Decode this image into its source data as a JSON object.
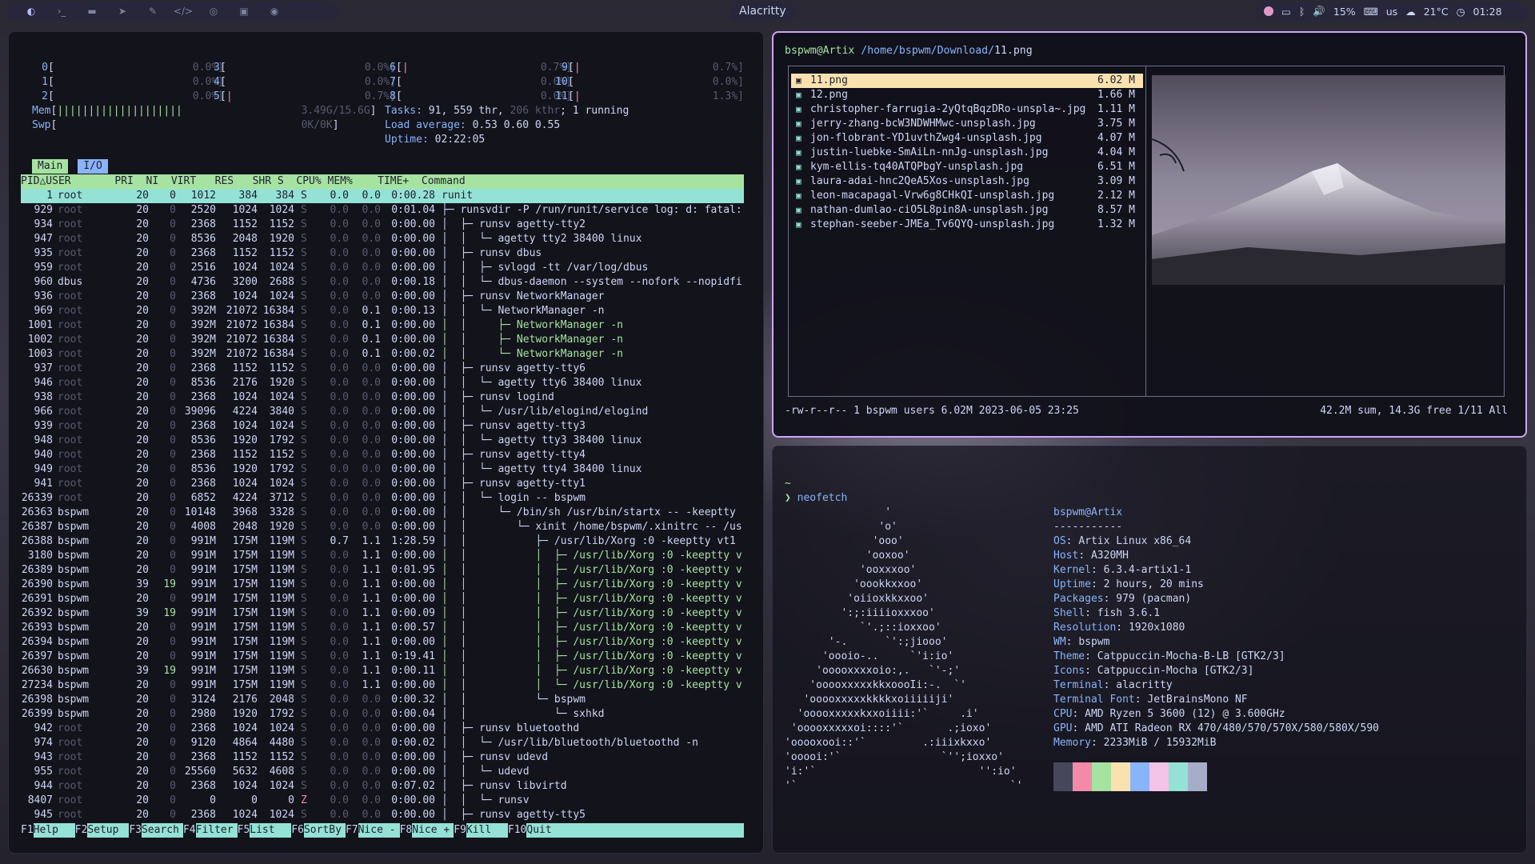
{
  "topbar": {
    "workspaces": [
      "",
      "",
      "",
      "",
      "",
      "",
      "",
      "",
      ""
    ],
    "title": "Alacritty",
    "battery": "15%",
    "keyboard": "us",
    "weather": "21°C",
    "clock": "01:28",
    "status_icons": [
      "wifi-icon",
      "display-icon",
      "bluetooth-icon"
    ]
  },
  "htop": {
    "cpus": [
      {
        "n": "0",
        "p": "0.0%"
      },
      {
        "n": "1",
        "p": "0.0%"
      },
      {
        "n": "2",
        "p": "0.0%"
      },
      {
        "n": "3",
        "p": "0.0%"
      },
      {
        "n": "4",
        "p": "0.0%"
      },
      {
        "n": "5",
        "p": "0.7%"
      },
      {
        "n": "6",
        "p": "0.7%"
      },
      {
        "n": "7",
        "p": "0.0%"
      },
      {
        "n": "8",
        "p": "0.0%"
      },
      {
        "n": "9",
        "p": "0.7%"
      },
      {
        "n": "10",
        "p": "0.0%"
      },
      {
        "n": "11",
        "p": "1.3%"
      }
    ],
    "mem_label": "Mem",
    "mem_bar": "||||||||||||||||||||",
    "mem_value": "3.49G/15.6G",
    "swp_label": "Swp",
    "swp_value": "0K/0K",
    "tasks_label": "Tasks:",
    "tasks_value": "91, 559 thr, ",
    "tasks_kthr": "206 kthr",
    "tasks_running": "; 1 running",
    "load_label": "Load average:",
    "load_value": "0.53 0.60 0.55",
    "uptime_label": "Uptime:",
    "uptime_value": "02:22:05",
    "tabs": [
      "Main",
      "I/O"
    ],
    "header": "PID△USER       PRI  NI  VIRT   RES   SHR S  CPU% MEM%    TIME+  Command",
    "rows": [
      [
        "1",
        "root",
        "20",
        "0",
        "1012",
        "384",
        "384",
        "S",
        "0.0",
        "0.0",
        "0:00.28",
        "runit"
      ],
      [
        "929",
        "root",
        "20",
        "0",
        "2520",
        "1024",
        "1024",
        "S",
        "0.0",
        "0.0",
        "0:01.04",
        "├─ runsvdir -P /run/runit/service log: d: fatal:"
      ],
      [
        "934",
        "root",
        "20",
        "0",
        "2368",
        "1152",
        "1152",
        "S",
        "0.0",
        "0.0",
        "0:00.00",
        "│  ├─ runsv agetty-tty2"
      ],
      [
        "947",
        "root",
        "20",
        "0",
        "8536",
        "2048",
        "1920",
        "S",
        "0.0",
        "0.0",
        "0:00.00",
        "│  │  └─ agetty tty2 38400 linux"
      ],
      [
        "935",
        "root",
        "20",
        "0",
        "2368",
        "1152",
        "1152",
        "S",
        "0.0",
        "0.0",
        "0:00.00",
        "│  ├─ runsv dbus"
      ],
      [
        "959",
        "root",
        "20",
        "0",
        "2516",
        "1024",
        "1024",
        "S",
        "0.0",
        "0.0",
        "0:00.00",
        "│  │  ├─ svlogd -tt /var/log/dbus"
      ],
      [
        "960",
        "dbus",
        "20",
        "0",
        "4736",
        "3200",
        "2688",
        "S",
        "0.0",
        "0.0",
        "0:00.18",
        "│  │  └─ dbus-daemon --system --nofork --nopidfi"
      ],
      [
        "936",
        "root",
        "20",
        "0",
        "2368",
        "1024",
        "1024",
        "S",
        "0.0",
        "0.0",
        "0:00.00",
        "│  ├─ runsv NetworkManager"
      ],
      [
        "969",
        "root",
        "20",
        "0",
        "392M",
        "21072",
        "16384",
        "S",
        "0.0",
        "0.1",
        "0:00.13",
        "│  │  └─ NetworkManager -n"
      ],
      [
        "1001",
        "root",
        "20",
        "0",
        "392M",
        "21072",
        "16384",
        "S",
        "0.0",
        "0.1",
        "0:00.00",
        "│  │     ├─ NetworkManager -n"
      ],
      [
        "1002",
        "root",
        "20",
        "0",
        "392M",
        "21072",
        "16384",
        "S",
        "0.0",
        "0.1",
        "0:00.00",
        "│  │     ├─ NetworkManager -n"
      ],
      [
        "1003",
        "root",
        "20",
        "0",
        "392M",
        "21072",
        "16384",
        "S",
        "0.0",
        "0.1",
        "0:00.02",
        "│  │     └─ NetworkManager -n"
      ],
      [
        "937",
        "root",
        "20",
        "0",
        "2368",
        "1152",
        "1152",
        "S",
        "0.0",
        "0.0",
        "0:00.00",
        "│  ├─ runsv agetty-tty6"
      ],
      [
        "946",
        "root",
        "20",
        "0",
        "8536",
        "2176",
        "1920",
        "S",
        "0.0",
        "0.0",
        "0:00.00",
        "│  │  └─ agetty tty6 38400 linux"
      ],
      [
        "938",
        "root",
        "20",
        "0",
        "2368",
        "1024",
        "1024",
        "S",
        "0.0",
        "0.0",
        "0:00.00",
        "│  ├─ runsv logind"
      ],
      [
        "966",
        "root",
        "20",
        "0",
        "39096",
        "4224",
        "3840",
        "S",
        "0.0",
        "0.0",
        "0:00.00",
        "│  │  └─ /usr/lib/elogind/elogind"
      ],
      [
        "939",
        "root",
        "20",
        "0",
        "2368",
        "1024",
        "1024",
        "S",
        "0.0",
        "0.0",
        "0:00.00",
        "│  ├─ runsv agetty-tty3"
      ],
      [
        "948",
        "root",
        "20",
        "0",
        "8536",
        "1920",
        "1792",
        "S",
        "0.0",
        "0.0",
        "0:00.00",
        "│  │  └─ agetty tty3 38400 linux"
      ],
      [
        "940",
        "root",
        "20",
        "0",
        "2368",
        "1152",
        "1152",
        "S",
        "0.0",
        "0.0",
        "0:00.00",
        "│  ├─ runsv agetty-tty4"
      ],
      [
        "949",
        "root",
        "20",
        "0",
        "8536",
        "1920",
        "1792",
        "S",
        "0.0",
        "0.0",
        "0:00.00",
        "│  │  └─ agetty tty4 38400 linux"
      ],
      [
        "941",
        "root",
        "20",
        "0",
        "2368",
        "1024",
        "1024",
        "S",
        "0.0",
        "0.0",
        "0:00.00",
        "│  ├─ runsv agetty-tty1"
      ],
      [
        "26339",
        "root",
        "20",
        "0",
        "6852",
        "4224",
        "3712",
        "S",
        "0.0",
        "0.0",
        "0:00.00",
        "│  │  └─ login -- bspwm"
      ],
      [
        "26363",
        "bspwm",
        "20",
        "0",
        "10148",
        "3968",
        "3328",
        "S",
        "0.0",
        "0.0",
        "0:00.00",
        "│  │     └─ /bin/sh /usr/bin/startx -- -keeptty"
      ],
      [
        "26387",
        "bspwm",
        "20",
        "0",
        "4008",
        "2048",
        "1920",
        "S",
        "0.0",
        "0.0",
        "0:00.00",
        "│  │        └─ xinit /home/bspwm/.xinitrc -- /us"
      ],
      [
        "26388",
        "bspwm",
        "20",
        "0",
        "991M",
        "175M",
        "119M",
        "S",
        "0.7",
        "1.1",
        "1:28.59",
        "│  │           ├─ /usr/lib/Xorg :0 -keeptty vt1"
      ],
      [
        "3180",
        "bspwm",
        "20",
        "0",
        "991M",
        "175M",
        "119M",
        "S",
        "0.0",
        "1.1",
        "0:00.00",
        "│  │           │  ├─ /usr/lib/Xorg :0 -keeptty v"
      ],
      [
        "26389",
        "bspwm",
        "20",
        "0",
        "991M",
        "175M",
        "119M",
        "S",
        "0.0",
        "1.1",
        "0:01.95",
        "│  │           │  ├─ /usr/lib/Xorg :0 -keeptty v"
      ],
      [
        "26390",
        "bspwm",
        "39",
        "19",
        "991M",
        "175M",
        "119M",
        "S",
        "0.0",
        "1.1",
        "0:00.00",
        "│  │           │  ├─ /usr/lib/Xorg :0 -keeptty v"
      ],
      [
        "26391",
        "bspwm",
        "20",
        "0",
        "991M",
        "175M",
        "119M",
        "S",
        "0.0",
        "1.1",
        "0:00.00",
        "│  │           │  ├─ /usr/lib/Xorg :0 -keeptty v"
      ],
      [
        "26392",
        "bspwm",
        "39",
        "19",
        "991M",
        "175M",
        "119M",
        "S",
        "0.0",
        "1.1",
        "0:00.09",
        "│  │           │  ├─ /usr/lib/Xorg :0 -keeptty v"
      ],
      [
        "26393",
        "bspwm",
        "20",
        "0",
        "991M",
        "175M",
        "119M",
        "S",
        "0.0",
        "1.1",
        "0:00.57",
        "│  │           │  ├─ /usr/lib/Xorg :0 -keeptty v"
      ],
      [
        "26394",
        "bspwm",
        "20",
        "0",
        "991M",
        "175M",
        "119M",
        "S",
        "0.0",
        "1.1",
        "0:00.00",
        "│  │           │  ├─ /usr/lib/Xorg :0 -keeptty v"
      ],
      [
        "26397",
        "bspwm",
        "20",
        "0",
        "991M",
        "175M",
        "119M",
        "S",
        "0.0",
        "1.1",
        "0:19.41",
        "│  │           │  ├─ /usr/lib/Xorg :0 -keeptty v"
      ],
      [
        "26630",
        "bspwm",
        "39",
        "19",
        "991M",
        "175M",
        "119M",
        "S",
        "0.0",
        "1.1",
        "0:00.11",
        "│  │           │  ├─ /usr/lib/Xorg :0 -keeptty v"
      ],
      [
        "27234",
        "bspwm",
        "20",
        "0",
        "991M",
        "175M",
        "119M",
        "S",
        "0.0",
        "1.1",
        "0:00.00",
        "│  │           │  └─ /usr/lib/Xorg :0 -keeptty v"
      ],
      [
        "26398",
        "bspwm",
        "20",
        "0",
        "3124",
        "2176",
        "2048",
        "S",
        "0.0",
        "0.0",
        "0:00.32",
        "│  │           └─ bspwm"
      ],
      [
        "26399",
        "bspwm",
        "20",
        "0",
        "2980",
        "1920",
        "1792",
        "S",
        "0.0",
        "0.0",
        "0:00.04",
        "│  │              └─ sxhkd"
      ],
      [
        "942",
        "root",
        "20",
        "0",
        "2368",
        "1024",
        "1024",
        "S",
        "0.0",
        "0.0",
        "0:00.00",
        "│  ├─ runsv bluetoothd"
      ],
      [
        "974",
        "root",
        "20",
        "0",
        "9120",
        "4864",
        "4480",
        "S",
        "0.0",
        "0.0",
        "0:00.02",
        "│  │  └─ /usr/lib/bluetooth/bluetoothd -n"
      ],
      [
        "943",
        "root",
        "20",
        "0",
        "2368",
        "1152",
        "1152",
        "S",
        "0.0",
        "0.0",
        "0:00.00",
        "│  ├─ runsv udevd"
      ],
      [
        "955",
        "root",
        "20",
        "0",
        "25560",
        "5632",
        "4608",
        "S",
        "0.0",
        "0.0",
        "0:00.00",
        "│  │  └─ udevd"
      ],
      [
        "944",
        "root",
        "20",
        "0",
        "2368",
        "1024",
        "1024",
        "S",
        "0.0",
        "0.0",
        "0:07.02",
        "│  ├─ runsv libvirtd"
      ],
      [
        "8407",
        "root",
        "20",
        "0",
        "0",
        "0",
        "0",
        "Z",
        "0.0",
        "0.0",
        "0:00.00",
        "│  │  └─ runsv"
      ],
      [
        "945",
        "root",
        "20",
        "0",
        "2368",
        "1024",
        "1024",
        "S",
        "0.0",
        "0.0",
        "0:00.00",
        "│  ├─ runsv agetty-tty5"
      ]
    ],
    "fkeys": [
      {
        "k": "F1",
        "l": "Help"
      },
      {
        "k": "F2",
        "l": "Setup"
      },
      {
        "k": "F3",
        "l": "Search"
      },
      {
        "k": "F4",
        "l": "Filter"
      },
      {
        "k": "F5",
        "l": "List"
      },
      {
        "k": "F6",
        "l": "SortBy"
      },
      {
        "k": "F7",
        "l": "Nice -"
      },
      {
        "k": "F8",
        "l": "Nice +"
      },
      {
        "k": "F9",
        "l": "Kill"
      },
      {
        "k": "F10",
        "l": "Quit"
      }
    ]
  },
  "filemanager": {
    "user": "bspwm@Artix",
    "path": "/home/bspwm/Download/",
    "file": "11.png",
    "files": [
      {
        "name": "11.png",
        "size": "6.02 M"
      },
      {
        "name": "12.png",
        "size": "1.66 M"
      },
      {
        "name": "christopher-farrugia-2yQtqBqzDRo-unspla~.jpg",
        "size": "1.11 M"
      },
      {
        "name": "jerry-zhang-bcW3NDWHMwc-unsplash.jpg",
        "size": "3.75 M"
      },
      {
        "name": "jon-flobrant-YD1uvthZwg4-unsplash.jpg",
        "size": "4.07 M"
      },
      {
        "name": "justin-luebke-SmAiLn-nnJg-unsplash.jpg",
        "size": "4.04 M"
      },
      {
        "name": "kym-ellis-tq40ATQPbgY-unsplash.jpg",
        "size": "6.51 M"
      },
      {
        "name": "laura-adai-hnc2QeA5Xos-unsplash.jpg",
        "size": "3.09 M"
      },
      {
        "name": "leon-macapagal-Vrw6g8CHkQI-unsplash.jpg",
        "size": "2.12 M"
      },
      {
        "name": "nathan-dumlao-ciO5L8pin8A-unsplash.jpg",
        "size": "8.57 M"
      },
      {
        "name": "stephan-seeber-JMEa_Tv6QYQ-unsplash.jpg",
        "size": "1.32 M"
      }
    ],
    "status_left": "-rw-r--r-- 1 bspwm users 6.02M 2023-06-05 23:25",
    "status_right": "42.2M sum, 14.3G free  1/11  All"
  },
  "neofetch": {
    "tilde": "~",
    "prompt_symbol": "❯",
    "command": "neofetch",
    "ascii": "                '\n               'o'\n              'ooo'\n             'ooxoo'\n            'ooxxxoo'\n           'oookkxxoo'\n          'oiioxkkxxoo'\n         ':;:iiiioxxxoo'\n            `'.;::ioxxoo'\n       '-.      `':;jiooo'\n      'oooio-..     `'i:io'\n     'ooooxxxxoio:,.   `'-;'\n    'ooooxxxxxkkxoooIi:-.  `'\n   'ooooxxxxxkkkkxoiiiiiji'\n  'ooooxxxxxkxxoiiii:'`     .i'\n 'ooooxxxxxoi::::'`       .;ioxo'\n'ooooxooi::'`         .:iiixkxxo'\n'ooooi:'`                `'';ioxxo'\n'i:'`                          '':io'\n'`                                  `'",
    "header": "bspwm@Artix",
    "sep": "-----------",
    "info": [
      {
        "k": "OS",
        "v": "Artix Linux x86_64"
      },
      {
        "k": "Host",
        "v": "A320MH"
      },
      {
        "k": "Kernel",
        "v": "6.3.4-artix1-1"
      },
      {
        "k": "Uptime",
        "v": "2 hours, 20 mins"
      },
      {
        "k": "Packages",
        "v": "979 (pacman)"
      },
      {
        "k": "Shell",
        "v": "fish 3.6.1"
      },
      {
        "k": "Resolution",
        "v": "1920x1080"
      },
      {
        "k": "WM",
        "v": "bspwm"
      },
      {
        "k": "Theme",
        "v": "Catppuccin-Mocha-B-LB [GTK2/3]"
      },
      {
        "k": "Icons",
        "v": "Catppuccin-Mocha [GTK2/3]"
      },
      {
        "k": "Terminal",
        "v": "alacritty"
      },
      {
        "k": "Terminal Font",
        "v": "JetBrainsMono NF"
      },
      {
        "k": "CPU",
        "v": "AMD Ryzen 5 3600 (12) @ 3.600GHz"
      },
      {
        "k": "GPU",
        "v": "AMD ATI Radeon RX 470/480/570/570X/580/580X/590"
      },
      {
        "k": "Memory",
        "v": "2233MiB / 15932MiB"
      }
    ],
    "palette": [
      "#45475a",
      "#f38ba8",
      "#a6e3a1",
      "#f9e2af",
      "#89b4fa",
      "#f5c2e7",
      "#94e2d5",
      "#a6adc8"
    ]
  }
}
